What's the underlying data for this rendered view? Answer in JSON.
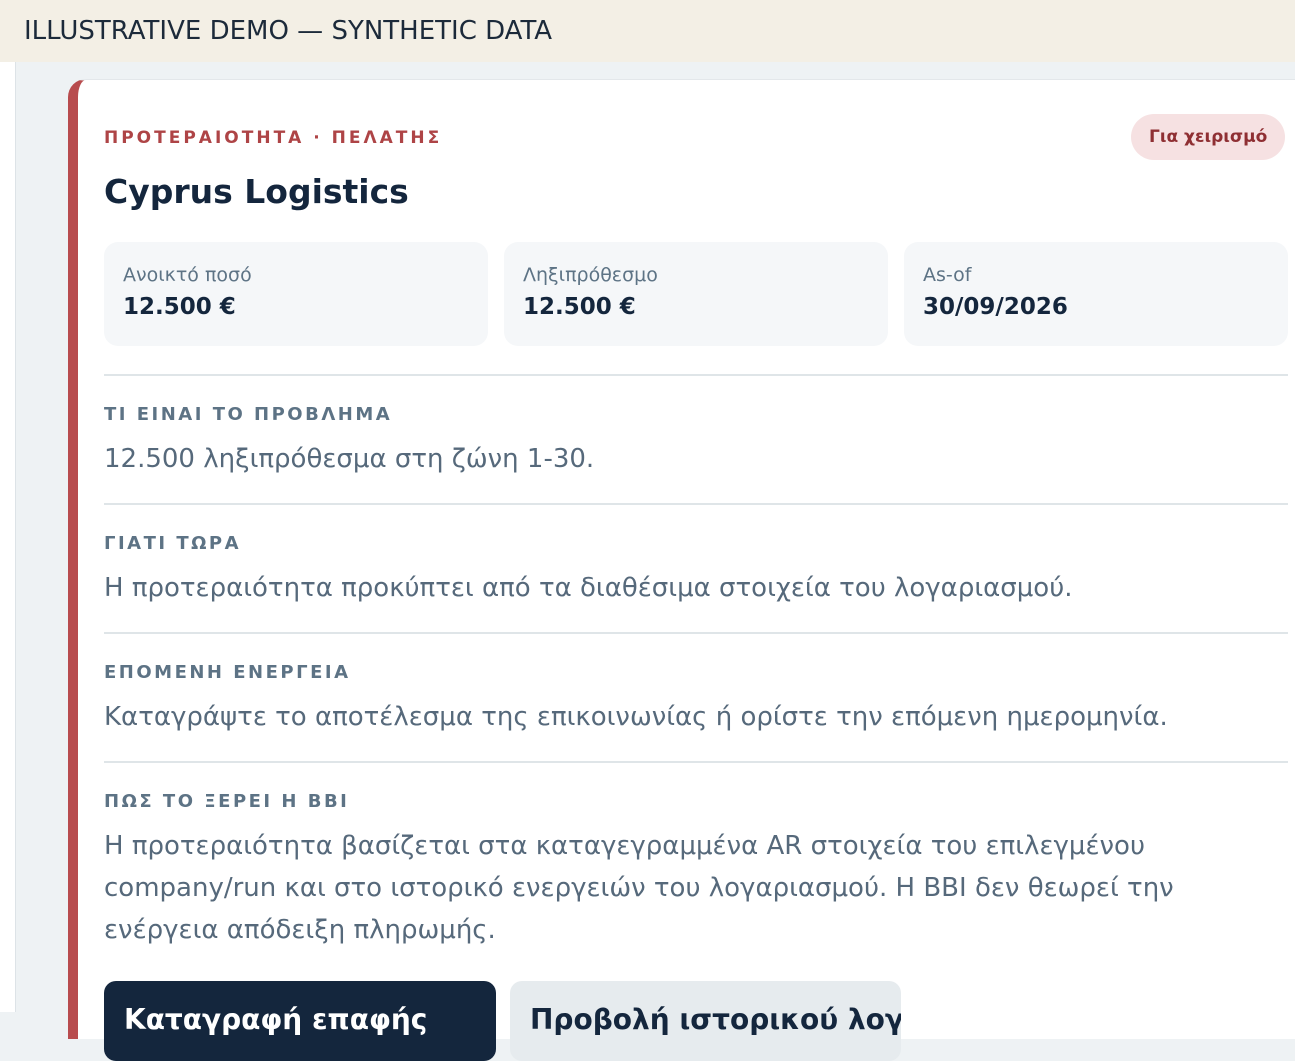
{
  "banner": {
    "text": "ILLUSTRATIVE DEMO — SYNTHETIC DATA"
  },
  "card": {
    "eyebrow": "ΠΡΟΤΕΡΑΙΟΤΗΤΑ · ΠΕΛΑΤΗΣ",
    "badge": "Για χειρισμό",
    "title": "Cyprus Logistics",
    "accent_color": "#b84c4e",
    "stats": [
      {
        "label": "Ανοικτό ποσό",
        "value": "12.500 €"
      },
      {
        "label": "Ληξιπρόθεσμο",
        "value": "12.500 €"
      },
      {
        "label": "As-of",
        "value": "30/09/2026"
      }
    ],
    "sections": [
      {
        "heading": "ΤΙ ΕΙΝΑΙ ΤΟ ΠΡΟΒΛΗΜΑ",
        "text": "12.500 ληξιπρόθεσμα στη ζώνη 1-30."
      },
      {
        "heading": "ΓΙΑΤΙ ΤΩΡΑ",
        "text": "Η προτεραιότητα προκύπτει από τα διαθέσιμα στοιχεία του λογαριασμού."
      },
      {
        "heading": "ΕΠΟΜΕΝΗ ΕΝΕΡΓΕΙΑ",
        "text": "Καταγράψτε το αποτέλεσμα της επικοινωνίας ή ορίστε την επόμενη ημερομηνία."
      },
      {
        "heading": "ΠΩΣ ΤΟ ΞΕΡΕΙ Η BBI",
        "text": "Η προτεραιότητα βασίζεται στα καταγεγραμμένα AR στοιχεία του επιλεγμένου company/run και στο ιστορικό ενεργειών του λογαριασμού. Η BBI δεν θεωρεί την ενέργεια απόδειξη πληρωμής."
      }
    ],
    "buttons": {
      "primary_label": "Καταγραφή επαφής",
      "secondary_label": "Προβολή ιστορικού λογαριασμού"
    }
  }
}
